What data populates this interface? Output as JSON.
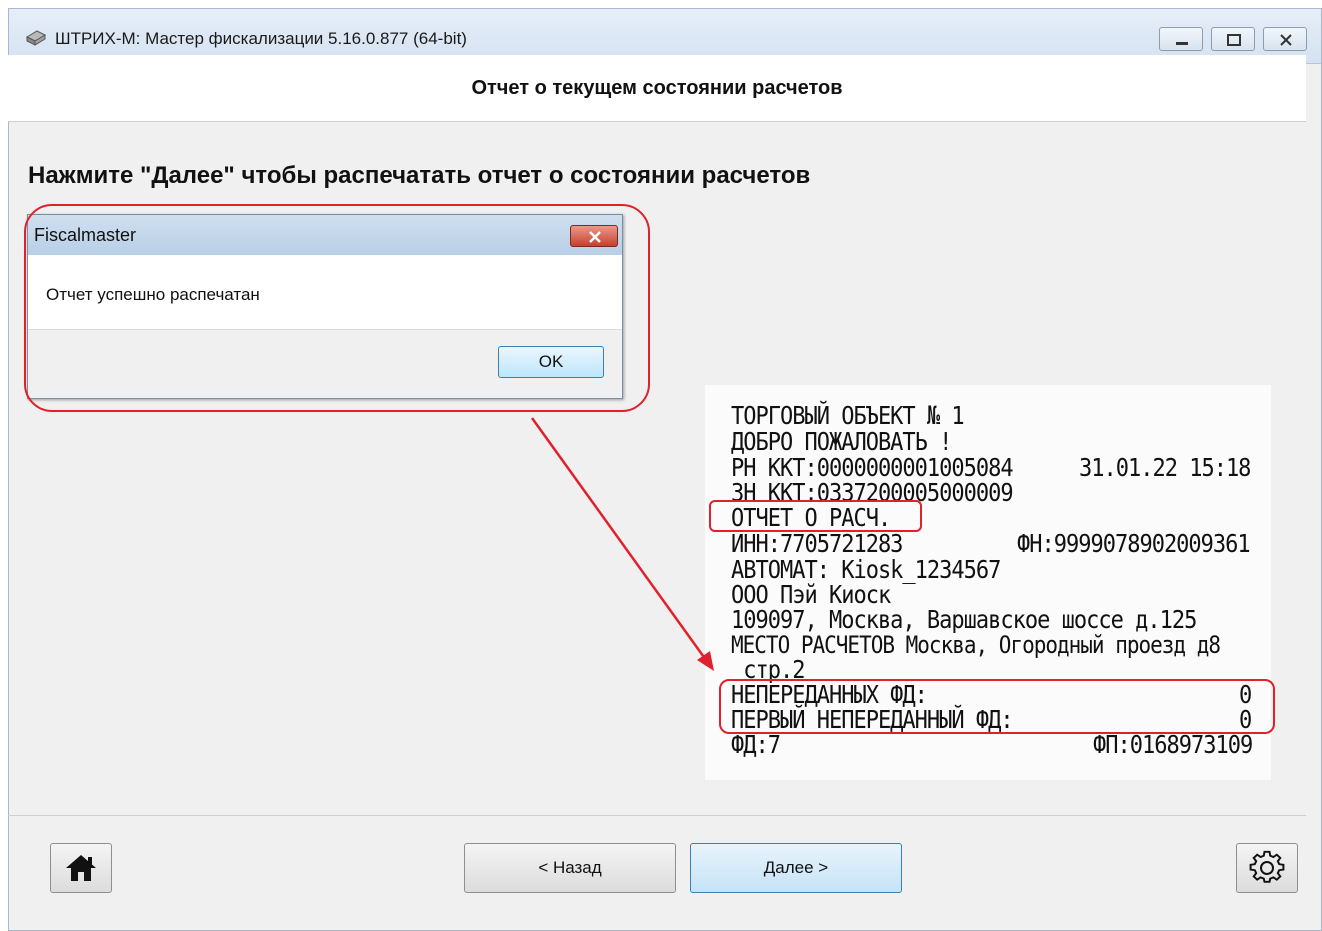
{
  "window": {
    "title": "ШТРИХ-М: Мастер фискализации 5.16.0.877 (64-bit)"
  },
  "header": {
    "title": "Отчет о текущем состоянии расчетов"
  },
  "instruction": "Нажмите \"Далее\" чтобы распечатать отчет о состоянии расчетов",
  "dialog": {
    "title": "Fiscalmaster",
    "message": "Отчет успешно распечатан",
    "ok_label": "OK"
  },
  "receipt": {
    "lines": [
      "ТОРГОВЫЙ ОБЪЕКТ № 1",
      "ДОБРО ПОЖАЛОВАТЬ !",
      "РН ККТ:0000000001005084",
      "ЗН ККТ:0337200005000009",
      "ОТЧЕТ О РАСЧ.",
      "ИНН:7705721283",
      "АВТОМАТ: Kiosk_1234567",
      "ООО Пэй Киоск",
      "109097, Москва, Варшавское шоссе д.125",
      "МЕСТО РАСЧЕТОВ Москва, Огородный проезд д8",
      " стр.2",
      "НЕПЕРЕДАННЫХ ФД:",
      "ПЕРВЫЙ НЕПЕРЕДАННЫЙ ФД:",
      "ФД:7"
    ],
    "datetime": "31.01.22 15:18",
    "fn": "ФН:9999078902009361",
    "untransmitted_count": "0",
    "first_untransmitted": "0",
    "fp": "ФП:0168973109"
  },
  "footer": {
    "back_label": "< Назад",
    "next_label": "Далее >"
  },
  "colors": {
    "annotation": "#e0202a",
    "accent_border": "#3c7fb1"
  },
  "icons": {
    "app": "printer-icon",
    "home": "home-icon",
    "settings": "gear-icon",
    "close": "close-icon"
  }
}
